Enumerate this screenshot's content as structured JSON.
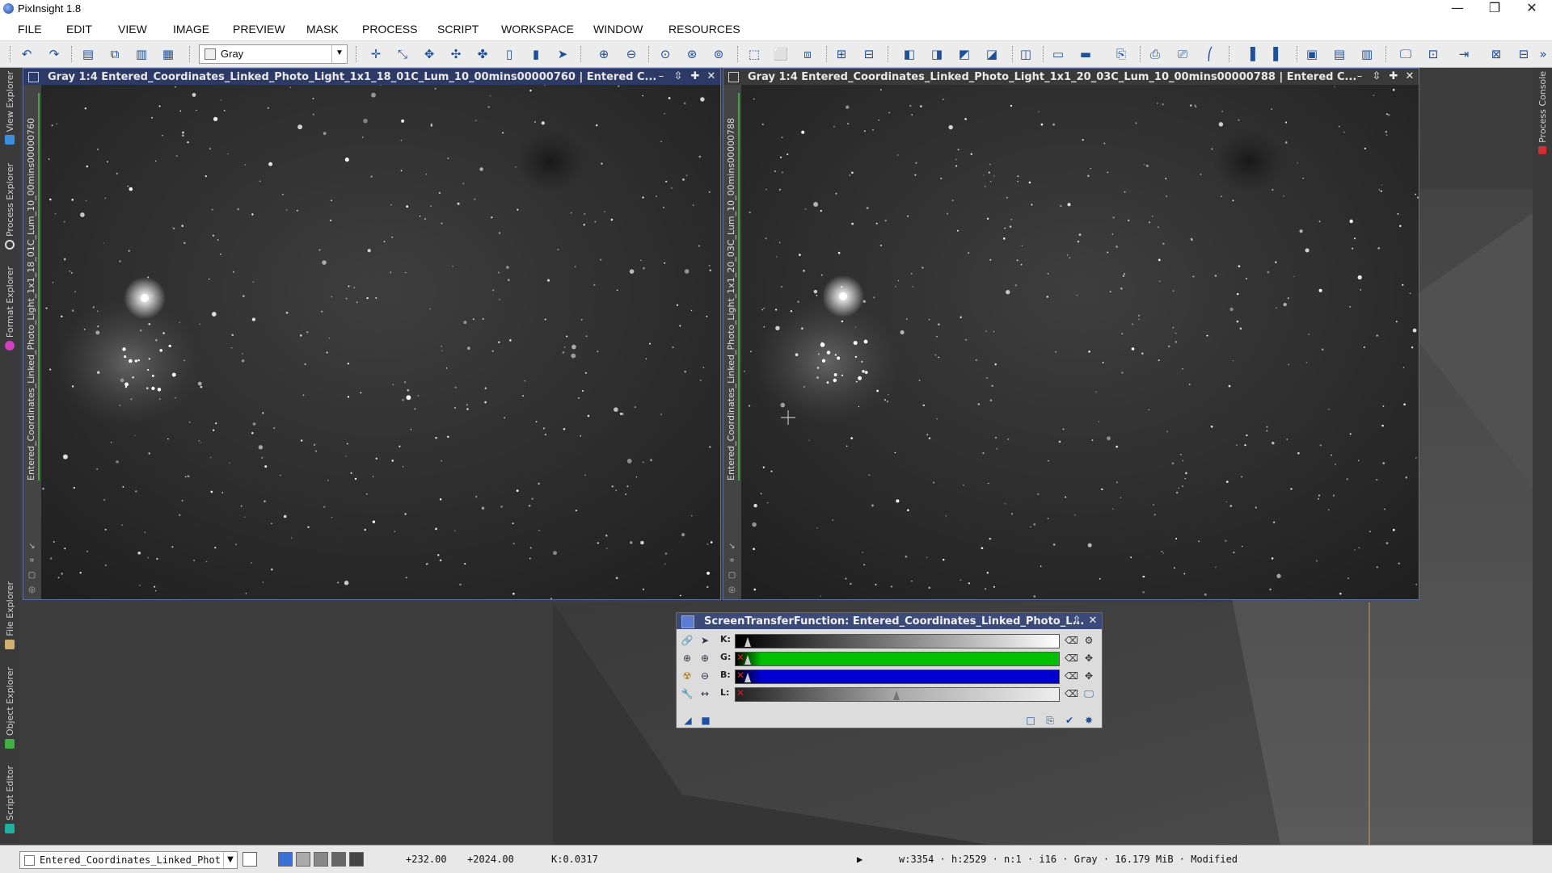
{
  "app": {
    "title": "PixInsight 1.8"
  },
  "window_controls": {
    "minimize": "—",
    "maximize": "❐",
    "close": "✕"
  },
  "menu": [
    "FILE",
    "EDIT",
    "VIEW",
    "IMAGE",
    "PREVIEW",
    "MASK",
    "PROCESS",
    "SCRIPT",
    "WORKSPACE",
    "WINDOW",
    "RESOURCES"
  ],
  "toolbar": {
    "view_select": "Gray",
    "more_glyph": "»"
  },
  "left_panels": {
    "view_explorer": "View Explorer",
    "process_explorer": "Process Explorer",
    "format_explorer": "Format Explorer",
    "file_explorer": "File Explorer",
    "object_explorer": "Object Explorer",
    "script_editor": "Script Editor"
  },
  "right_panels": {
    "process_console": "Process Console"
  },
  "image_windows": [
    {
      "title": "Gray 1:4 Entered_Coordinates_Linked_Photo_Light_1x1_18_01C_Lum_10_00mins00000760 | Entered C...",
      "vertical_title": "Entered_Coordinates_Linked_Photo_Light_1x1_18_01C_Lum_10_00mins00000760",
      "active": true
    },
    {
      "title": "Gray 1:4 Entered_Coordinates_Linked_Photo_Light_1x1_20_03C_Lum_10_00mins00000788 | Entered C...",
      "vertical_title": "Entered_Coordinates_Linked_Photo_Light_1x1_20_03C_Lum_10_00mins00000788",
      "active": false
    }
  ],
  "stf": {
    "title": "ScreenTransferFunction: Entered_Coordinates_Linked_Photo_L...",
    "rows": [
      {
        "label": "K:",
        "color": "#c0c0c0",
        "midtone": 0.0,
        "has_x": false
      },
      {
        "label": "G:",
        "color": "#00c000",
        "midtone": 0.0,
        "has_x": true
      },
      {
        "label": "B:",
        "color": "#0000d0",
        "midtone": 0.0,
        "has_x": true
      },
      {
        "label": "L:",
        "color": "#808080",
        "midtone": 0.5,
        "has_x": true
      }
    ]
  },
  "status": {
    "view_name": "Entered_Coordinates_Linked_Phot",
    "x": "+232.00",
    "y": "+2024.00",
    "k_value": "K:0.0317",
    "info": "w:3354 · h:2529 · n:1 · i16 · Gray · 16.179 MiB · Modified",
    "play_glyph": "▶"
  },
  "colors": {
    "accent": "#2e3a66",
    "workspace": "#3c3c3c",
    "link_green": "#3fa83f"
  }
}
